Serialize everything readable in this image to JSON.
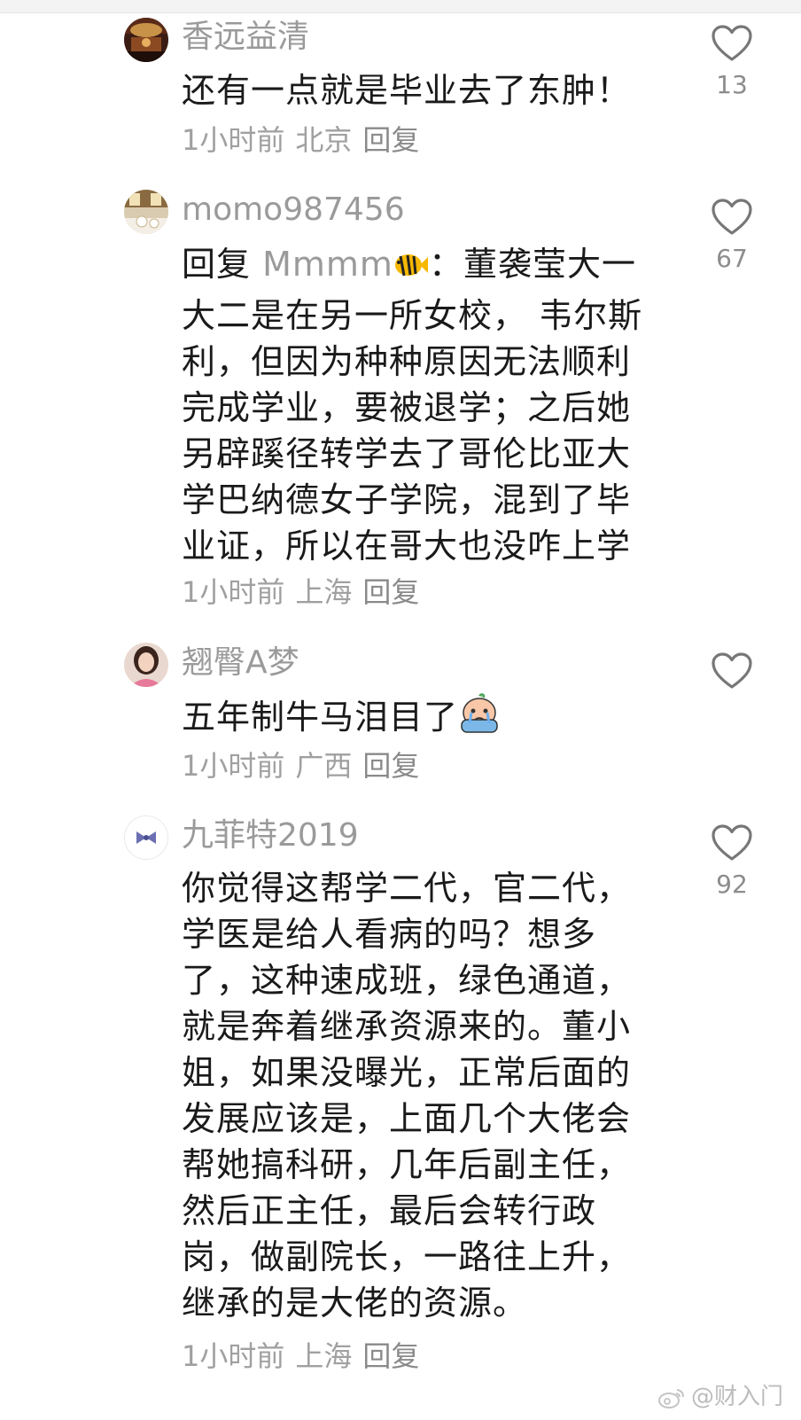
{
  "comments": [
    {
      "username": "香远益清",
      "content": "还有一点就是毕业去了东肿！",
      "time": "1小时前",
      "location": "北京",
      "reply_label": "回复",
      "likes": "13",
      "avatar_icon": "avatar-palace-icon"
    },
    {
      "username": "momo987456",
      "reply_prefix": "回复",
      "reply_target": "Mmmm",
      "content": "：董袭莹大一大二是在另一所女校， 韦尔斯利，但因为种种原因无法顺利完成学业，要被退学；之后她另辟蹊径转学去了哥伦比亚大学巴纳德女子学院，混到了毕业证，所以在哥大也没咋上学",
      "time": "1小时前",
      "location": "上海",
      "reply_label": "回复",
      "likes": "67",
      "avatar_icon": "avatar-interior-icon",
      "emoji": "fish-emoji-icon"
    },
    {
      "username": "翘臀A梦",
      "content": "五年制牛马泪目了",
      "time": "1小时前",
      "location": "广西",
      "reply_label": "回复",
      "likes": "",
      "avatar_icon": "avatar-person-icon",
      "emoji": "crying-face-emoji-icon"
    },
    {
      "username": "九菲特2019",
      "content": "你觉得这帮学二代，官二代，学医是给人看病的吗？想多了，这种速成班，绿色通道，就是奔着继承资源来的。董小姐，如果没曝光，正常后面的发展应该是，上面几个大佬会帮她搞科研，几年后副主任，然后正主任，最后会转行政岗，做副院长，一路往上升，继承的是大佬的资源。",
      "time": "1小时前",
      "location": "上海",
      "reply_label": "回复",
      "likes": "92",
      "avatar_icon": "avatar-bow-icon"
    }
  ],
  "watermark": "@财入门",
  "colors": {
    "username": "#9a9a9a",
    "content": "#1a1a1a",
    "meta": "#a0a0a0",
    "heart_stroke": "#777777"
  }
}
